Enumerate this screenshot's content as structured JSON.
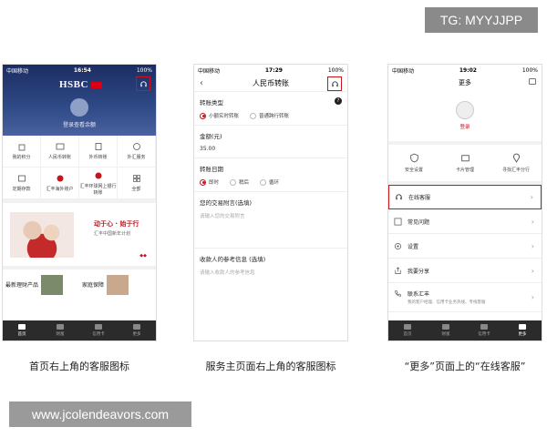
{
  "watermark_top": "TG: MYYJJPP",
  "watermark_bottom": "www.jcolendeavors.com",
  "captions": [
    "首页右上角的客服图标",
    "服务主页面右上角的客服图标",
    "“更多”页面上的“在线客服”"
  ],
  "phone1": {
    "status": {
      "carrier": "中国移动",
      "time": "16:54",
      "battery": "100%"
    },
    "logo": "HSBC",
    "login": "登录查看余额",
    "grid": [
      "我的积分",
      "人民币转账",
      "外币转账",
      "外汇服务",
      "定期存款",
      "汇丰海外账户",
      "汇丰环球网上银行转账",
      "全部"
    ],
    "banner": {
      "title": "动于心 · 始于行",
      "sub": "汇丰中国新年计划"
    },
    "cards": [
      "最新理财产品",
      "家庭保障"
    ],
    "tabs": [
      "首页",
      "财富",
      "信用卡",
      "更多"
    ]
  },
  "phone2": {
    "status": {
      "carrier": "中国移动",
      "time": "17:29",
      "battery": "100%"
    },
    "title": "人民币转账",
    "transfer_type": {
      "label": "转账类型",
      "options": [
        "小额实时转账",
        "普通跨行转账"
      ],
      "selected": 0
    },
    "amount": {
      "label": "金额(元)",
      "value": "35.00"
    },
    "date": {
      "label": "转账日期",
      "options": [
        "即时",
        "稍后",
        "循环"
      ],
      "selected": 0
    },
    "remark": {
      "label": "您的交易附言(选填)",
      "placeholder": "请输入您的交易附言"
    },
    "ref": {
      "label": "收款人的参考信息 (选填)",
      "placeholder": "请输入收款人的参考信息"
    }
  },
  "phone3": {
    "status": {
      "carrier": "中国移动",
      "time": "19:02",
      "battery": "100%"
    },
    "title": "更多",
    "login": "登录",
    "quick": [
      "安全设置",
      "卡片管理",
      "寻找汇丰分行"
    ],
    "menu": [
      "在线客服",
      "常见问题",
      "设置",
      "我要分享"
    ],
    "contact": {
      "label": "联系汇丰",
      "desc": "我的客户经理、信用卡业务热线、专线客服"
    },
    "tabs": [
      "首页",
      "财富",
      "信用卡",
      "更多"
    ]
  },
  "colors": {
    "accent": "#c4161c",
    "hero": "#1c2c63",
    "tabbar": "#2b2b2b"
  }
}
